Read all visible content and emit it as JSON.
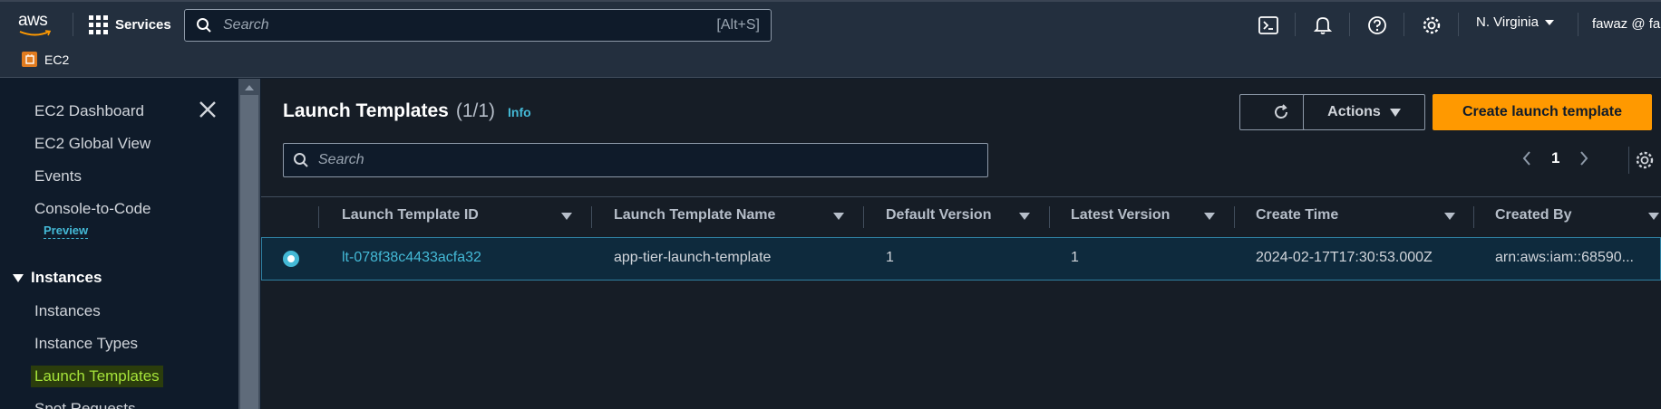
{
  "topbar": {
    "logo_text": "aws",
    "services_label": "Services",
    "search_placeholder": "Search",
    "search_shortcut": "[Alt+S]",
    "region_label": "N. Virginia",
    "user_label": "fawaz @ fa",
    "icons": [
      "cloudshell-icon",
      "bell-icon",
      "help-icon",
      "settings-icon"
    ]
  },
  "breadcrumb": {
    "service_label": "EC2"
  },
  "sidebar": {
    "items": [
      {
        "label": "EC2 Dashboard"
      },
      {
        "label": "EC2 Global View"
      },
      {
        "label": "Events"
      },
      {
        "label": "Console-to-Code"
      }
    ],
    "preview_label": "Preview",
    "section_label": "Instances",
    "section_items": [
      {
        "label": "Instances"
      },
      {
        "label": "Instance Types"
      },
      {
        "label": "Launch Templates"
      },
      {
        "label": "Spot Requests"
      }
    ]
  },
  "panel": {
    "title": "Launch Templates",
    "count": "(1/1)",
    "info_label": "Info",
    "actions_label": "Actions",
    "create_label": "Create launch template",
    "filter_placeholder": "Search",
    "page_number": "1"
  },
  "table": {
    "columns": [
      "Launch Template ID",
      "Launch Template Name",
      "Default Version",
      "Latest Version",
      "Create Time",
      "Created By"
    ],
    "rows": [
      {
        "id": "lt-078f38c4433acfa32",
        "name": "app-tier-launch-template",
        "default_version": "1",
        "latest_version": "1",
        "create_time": "2024-02-17T17:30:53.000Z",
        "created_by": "arn:aws:iam::68590...",
        "selected": true
      }
    ]
  },
  "colors": {
    "accent": "#ff9900",
    "link": "#44b9d6",
    "topbar_bg": "#232f3e",
    "main_bg": "#161d26",
    "selected_row_bg": "#0e2a3d",
    "highlight_text": "#a6e43a"
  }
}
